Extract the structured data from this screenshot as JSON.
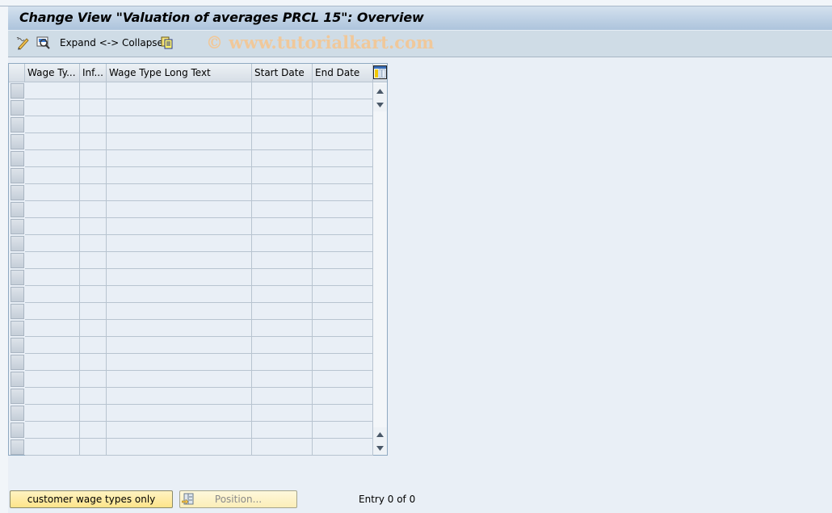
{
  "window": {
    "title": "Change View \"Valuation of averages PRCL 15\": Overview"
  },
  "toolbar": {
    "items": [
      {
        "icon": "display-change-icon",
        "label": ""
      },
      {
        "icon": "find-icon",
        "label": ""
      },
      {
        "icon": "",
        "label": "Expand <-> Collapse"
      },
      {
        "icon": "copy-icon",
        "label": ""
      }
    ],
    "watermark": "© www.tutorialkart.com"
  },
  "table": {
    "columns": [
      {
        "label": "Wage Ty..."
      },
      {
        "label": "Inf..."
      },
      {
        "label": "Wage Type Long Text"
      },
      {
        "label": "Start Date"
      },
      {
        "label": "End Date"
      }
    ],
    "column_settings_icon": "table-settings-icon",
    "rows": [
      [
        "",
        "",
        "",
        "",
        ""
      ],
      [
        "",
        "",
        "",
        "",
        ""
      ],
      [
        "",
        "",
        "",
        "",
        ""
      ],
      [
        "",
        "",
        "",
        "",
        ""
      ],
      [
        "",
        "",
        "",
        "",
        ""
      ],
      [
        "",
        "",
        "",
        "",
        ""
      ],
      [
        "",
        "",
        "",
        "",
        ""
      ],
      [
        "",
        "",
        "",
        "",
        ""
      ],
      [
        "",
        "",
        "",
        "",
        ""
      ],
      [
        "",
        "",
        "",
        "",
        ""
      ],
      [
        "",
        "",
        "",
        "",
        ""
      ],
      [
        "",
        "",
        "",
        "",
        ""
      ],
      [
        "",
        "",
        "",
        "",
        ""
      ],
      [
        "",
        "",
        "",
        "",
        ""
      ],
      [
        "",
        "",
        "",
        "",
        ""
      ],
      [
        "",
        "",
        "",
        "",
        ""
      ],
      [
        "",
        "",
        "",
        "",
        ""
      ],
      [
        "",
        "",
        "",
        "",
        ""
      ],
      [
        "",
        "",
        "",
        "",
        ""
      ],
      [
        "",
        "",
        "",
        "",
        ""
      ],
      [
        "",
        "",
        "",
        "",
        ""
      ],
      [
        "",
        "",
        "",
        "",
        ""
      ]
    ]
  },
  "footer": {
    "customer_button": "customer wage types only",
    "position_button": "Position...",
    "entry_text": "Entry 0 of 0"
  }
}
